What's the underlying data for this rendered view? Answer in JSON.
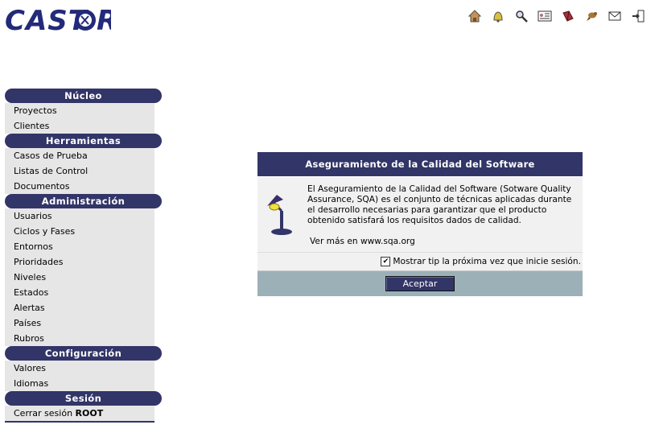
{
  "app": {
    "logo_text": "CASTOR"
  },
  "toolbar": {
    "icons": [
      "home-icon",
      "bell-icon",
      "search-icon",
      "id-card-icon",
      "book-icon",
      "beaver-icon",
      "mail-icon",
      "logout-icon"
    ]
  },
  "sidebar": {
    "sections": [
      {
        "title": "Núcleo",
        "items": [
          "Proyectos",
          "Clientes"
        ]
      },
      {
        "title": "Herramientas",
        "items": [
          "Casos de Prueba",
          "Listas de Control",
          "Documentos"
        ]
      },
      {
        "title": "Administración",
        "items": [
          "Usuarios",
          "Ciclos y Fases",
          "Entornos",
          "Prioridades",
          "Niveles",
          "Estados",
          "Alertas",
          "Países",
          "Rubros"
        ]
      },
      {
        "title": "Configuración",
        "items": [
          "Valores",
          "Idiomas"
        ]
      },
      {
        "title": "Sesión",
        "items": []
      }
    ],
    "logout_prefix": "Cerrar sesión",
    "logout_user": "ROOT"
  },
  "dialog": {
    "title": "Aseguramiento de la Calidad del Software",
    "body": "El Aseguramiento de la Calidad del Software (Sotware Quality Assurance, SQA) es el conjunto de técnicas aplicadas durante el desarrollo necesarias para garantizar que el producto obtenido satisfará los requisitos dados de calidad.",
    "link": "Ver más en www.sqa.org",
    "checkbox_label": "Mostrar tip la próxima vez que inicie sesión.",
    "checkbox_checked": true,
    "accept_label": "Aceptar"
  },
  "colors": {
    "accent": "#323567",
    "menu_bg": "#e6e6e6",
    "footer_bg": "#9cb0b8"
  }
}
